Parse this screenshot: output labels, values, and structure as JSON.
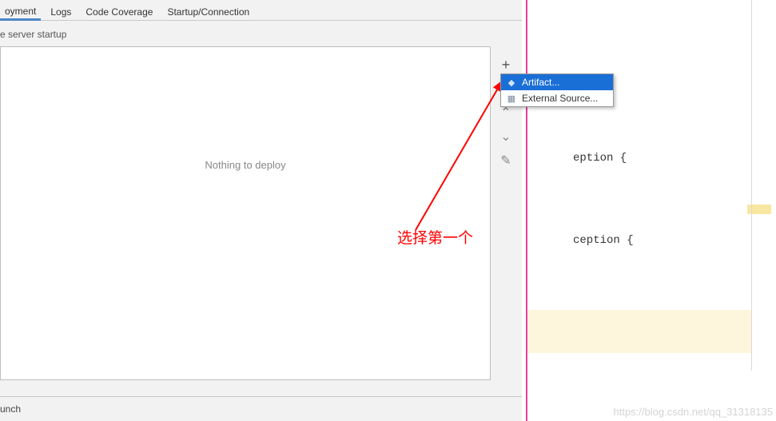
{
  "tabs": {
    "deployment": "oyment",
    "logs": "Logs",
    "coverage": "Code Coverage",
    "startup": "Startup/Connection"
  },
  "section_label": "e server startup",
  "deploy_placeholder": "Nothing to deploy",
  "bottom_label": "unch",
  "popup": {
    "artifact": "Artifact...",
    "external": "External Source..."
  },
  "annotation": "选择第一个",
  "code_fragment_1": "eption {",
  "code_fragment_2": "ception {",
  "watermark": "https://blog.csdn.net/qq_31318135"
}
